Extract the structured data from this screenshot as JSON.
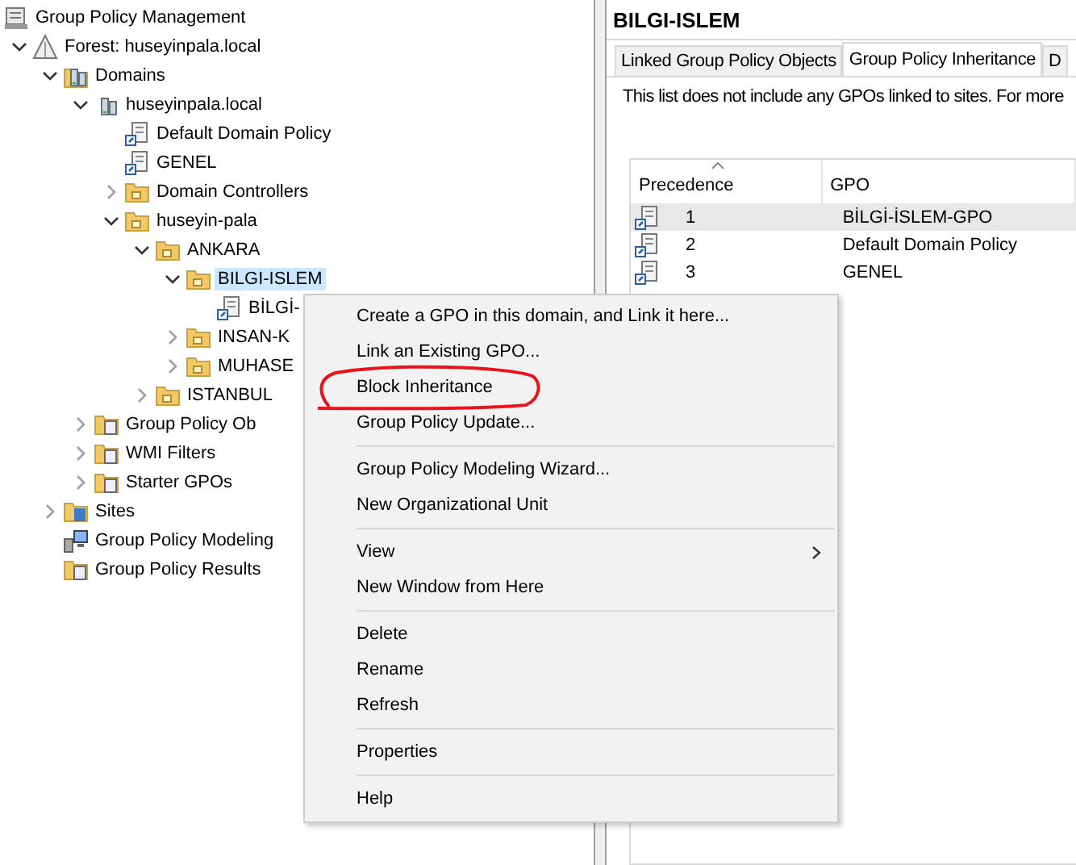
{
  "tree": {
    "title": "Group Policy Management",
    "kind": "console",
    "children": [
      {
        "label": "Forest: huseyinpala.local",
        "kind": "forest",
        "expanded": true,
        "selected": false,
        "children": [
          {
            "label": "Domains",
            "kind": "domains",
            "expanded": true,
            "selected": false,
            "children": [
              {
                "label": "huseyinpala.local",
                "kind": "domain",
                "expanded": true,
                "selected": false,
                "children": [
                  {
                    "label": "Default Domain Policy",
                    "kind": "gpo-link",
                    "selected": false
                  },
                  {
                    "label": "GENEL",
                    "kind": "gpo-link",
                    "selected": false
                  },
                  {
                    "label": "Domain Controllers",
                    "kind": "ou",
                    "expanded": false,
                    "selected": false
                  },
                  {
                    "label": "huseyin-pala",
                    "kind": "ou",
                    "expanded": true,
                    "selected": false,
                    "children": [
                      {
                        "label": "ANKARA",
                        "kind": "ou",
                        "expanded": true,
                        "selected": false,
                        "children": [
                          {
                            "label": "BILGI-ISLEM",
                            "kind": "ou",
                            "expanded": true,
                            "selected": true,
                            "children": [
                              {
                                "label": "BİLGİ-",
                                "kind": "gpo-link",
                                "selected": false
                              }
                            ]
                          },
                          {
                            "label": "INSAN-K",
                            "kind": "ou",
                            "expanded": false,
                            "selected": false
                          },
                          {
                            "label": "MUHASE",
                            "kind": "ou",
                            "expanded": false,
                            "selected": false
                          }
                        ]
                      },
                      {
                        "label": "ISTANBUL",
                        "kind": "ou",
                        "expanded": false,
                        "selected": false
                      }
                    ]
                  }
                ]
              },
              {
                "label": "Group Policy Ob",
                "kind": "gpo-folder",
                "expanded": false,
                "selected": false
              },
              {
                "label": "WMI Filters",
                "kind": "wmi-folder",
                "expanded": false,
                "selected": false
              },
              {
                "label": "Starter GPOs",
                "kind": "starter-folder",
                "expanded": false,
                "selected": false
              }
            ]
          },
          {
            "label": "Sites",
            "kind": "sites",
            "expanded": false,
            "selected": false
          },
          {
            "label": "Group Policy Modeling",
            "kind": "modeling",
            "selected": false
          },
          {
            "label": "Group Policy Results",
            "kind": "results",
            "selected": false
          }
        ]
      }
    ]
  },
  "details": {
    "title": "BILGI-ISLEM",
    "tabs": [
      {
        "label": "Linked Group Policy Objects",
        "selected": false
      },
      {
        "label": "Group Policy Inheritance",
        "selected": true
      },
      {
        "label": "D",
        "selected": false
      }
    ],
    "note": "This list does not include any GPOs linked to sites. For more",
    "table": {
      "columns": [
        {
          "label": "Precedence",
          "sorted": true
        },
        {
          "label": "GPO",
          "sorted": false
        }
      ],
      "rows": [
        {
          "precedence": "1",
          "gpo": "BİLGİ-İSLEM-GPO",
          "selected": true
        },
        {
          "precedence": "2",
          "gpo": "Default Domain Policy",
          "selected": false
        },
        {
          "precedence": "3",
          "gpo": "GENEL",
          "selected": false
        }
      ]
    }
  },
  "context_menu": {
    "items": [
      {
        "kind": "item",
        "label": "Create a GPO in this domain, and Link it here..."
      },
      {
        "kind": "item",
        "label": "Link an Existing GPO..."
      },
      {
        "kind": "item",
        "label": "Block Inheritance",
        "circled": true
      },
      {
        "kind": "item",
        "label": "Group Policy Update..."
      },
      {
        "kind": "separator"
      },
      {
        "kind": "item",
        "label": "Group Policy Modeling Wizard..."
      },
      {
        "kind": "item",
        "label": "New Organizational Unit"
      },
      {
        "kind": "separator"
      },
      {
        "kind": "item",
        "label": "View",
        "submenu": true
      },
      {
        "kind": "item",
        "label": "New Window from Here"
      },
      {
        "kind": "separator"
      },
      {
        "kind": "item",
        "label": "Delete"
      },
      {
        "kind": "item",
        "label": "Rename"
      },
      {
        "kind": "item",
        "label": "Refresh"
      },
      {
        "kind": "separator"
      },
      {
        "kind": "item",
        "label": "Properties"
      },
      {
        "kind": "separator"
      },
      {
        "kind": "item",
        "label": "Help"
      }
    ]
  }
}
